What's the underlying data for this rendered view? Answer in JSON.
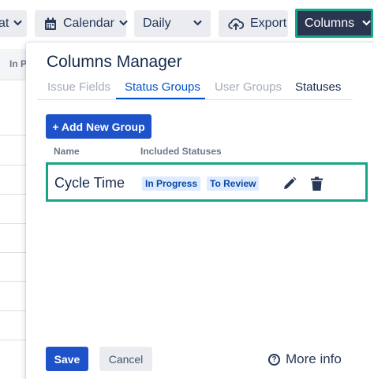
{
  "toolbar": {
    "format_label": "at",
    "calendar_label": "Calendar",
    "daily_label": "Daily",
    "export_label": "Export",
    "columns_label": "Columns"
  },
  "background_table": {
    "header": "In P"
  },
  "columns_manager": {
    "title": "Columns Manager",
    "tabs": [
      {
        "label": "Issue Fields",
        "state": "disabled"
      },
      {
        "label": "Status Groups",
        "state": "active"
      },
      {
        "label": "User Groups",
        "state": "disabled"
      },
      {
        "label": "Statuses",
        "state": "normal"
      }
    ],
    "add_button_label": "+ Add New Group",
    "columns": {
      "name": "Name",
      "included_statuses": "Included Statuses"
    },
    "groups": [
      {
        "name": "Cycle Time",
        "statuses": [
          "In Progress",
          "To Review"
        ],
        "edit_icon": "pencil-icon",
        "delete_icon": "trash-icon"
      }
    ],
    "save_label": "Save",
    "cancel_label": "Cancel",
    "more_info_label": "More info"
  },
  "colors": {
    "primary": "#1d52c9",
    "highlight_border": "#17a589",
    "columns_button_bg": "#2a3650",
    "lozenge_bg": "#deebff",
    "lozenge_text": "#0747a6"
  }
}
